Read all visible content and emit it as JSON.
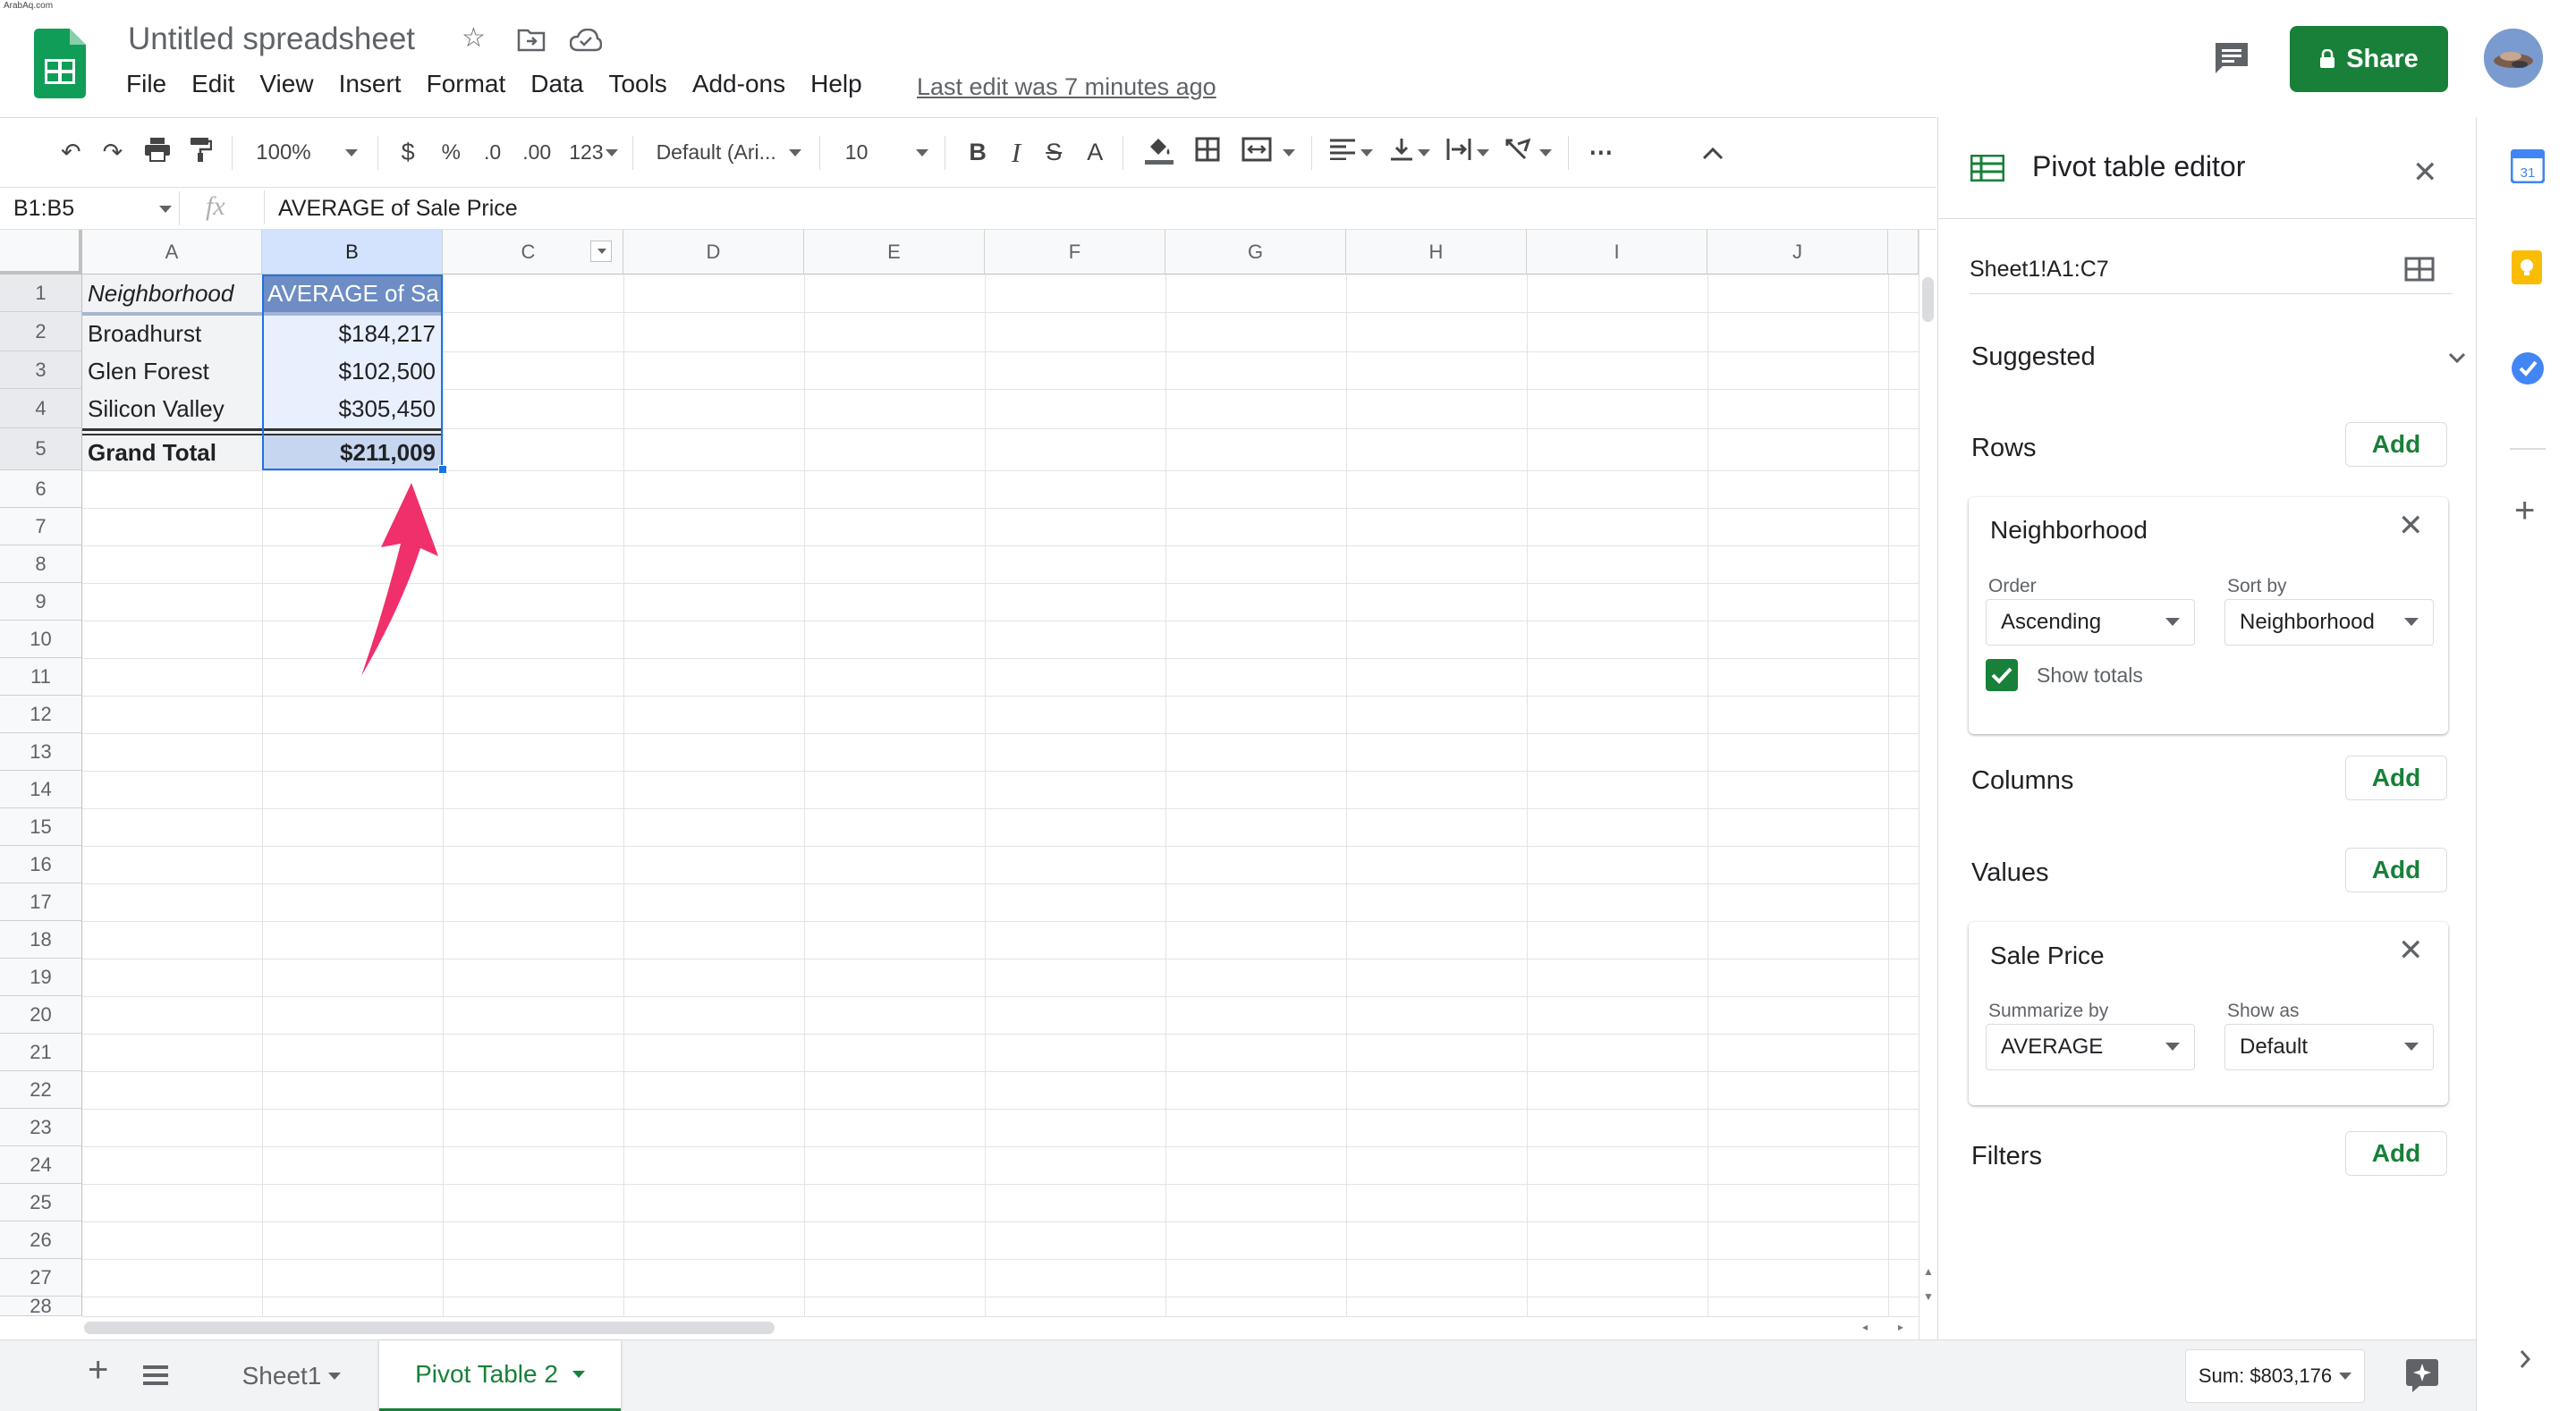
{
  "watermark": "ArabAq.com",
  "header": {
    "title": "Untitled spreadsheet",
    "menu": [
      "File",
      "Edit",
      "View",
      "Insert",
      "Format",
      "Data",
      "Tools",
      "Add-ons",
      "Help"
    ],
    "last_edit": "Last edit was 7 minutes ago",
    "share_label": "Share"
  },
  "toolbar": {
    "zoom": "100%",
    "currency": "$",
    "percent": "%",
    "dec_less": ".0",
    "dec_more": ".00",
    "more_formats": "123",
    "font": "Default (Ari...",
    "font_size": "10",
    "bold": "B",
    "italic": "I",
    "strike": "S",
    "text_color": "A",
    "more": "⋯"
  },
  "formula_bar": {
    "name_box": "B1:B5",
    "fx": "fx",
    "content": "AVERAGE of Sale Price"
  },
  "grid": {
    "columns": [
      "A",
      "B",
      "C",
      "D",
      "E",
      "F",
      "G",
      "H",
      "I",
      "J"
    ],
    "rows": [
      "1",
      "2",
      "3",
      "4",
      "5",
      "6",
      "7",
      "8",
      "9",
      "10",
      "11",
      "12",
      "13",
      "14",
      "15",
      "16",
      "17",
      "18",
      "19",
      "20",
      "21",
      "22",
      "23",
      "24",
      "25",
      "26",
      "27",
      "28"
    ],
    "header_a": "Neighborhood",
    "header_b": "AVERAGE of Sa",
    "data": [
      {
        "name": "Broadhurst",
        "value": "$184,217"
      },
      {
        "name": "Glen Forest",
        "value": "$102,500"
      },
      {
        "name": "Silicon Valley",
        "value": "$305,450"
      }
    ],
    "total_label": "Grand Total",
    "total_value": "$211,009"
  },
  "panel": {
    "title": "Pivot table editor",
    "range": "Sheet1!A1:C7",
    "suggested": "Suggested",
    "rows_label": "Rows",
    "columns_label": "Columns",
    "values_label": "Values",
    "filters_label": "Filters",
    "add": "Add",
    "row_card": {
      "title": "Neighborhood",
      "order_label": "Order",
      "order_value": "Ascending",
      "sort_label": "Sort by",
      "sort_value": "Neighborhood",
      "show_totals": "Show totals"
    },
    "value_card": {
      "title": "Sale Price",
      "summarize_label": "Summarize by",
      "summarize_value": "AVERAGE",
      "show_as_label": "Show as",
      "show_as_value": "Default"
    }
  },
  "bottom": {
    "tabs": [
      "Sheet1",
      "Pivot Table 2"
    ],
    "sum": "Sum: $803,176"
  },
  "colors": {
    "green": "#188038",
    "selection": "#e8f0fe",
    "header_blue": "#6d8dc4",
    "arrow": "#f0306a"
  }
}
